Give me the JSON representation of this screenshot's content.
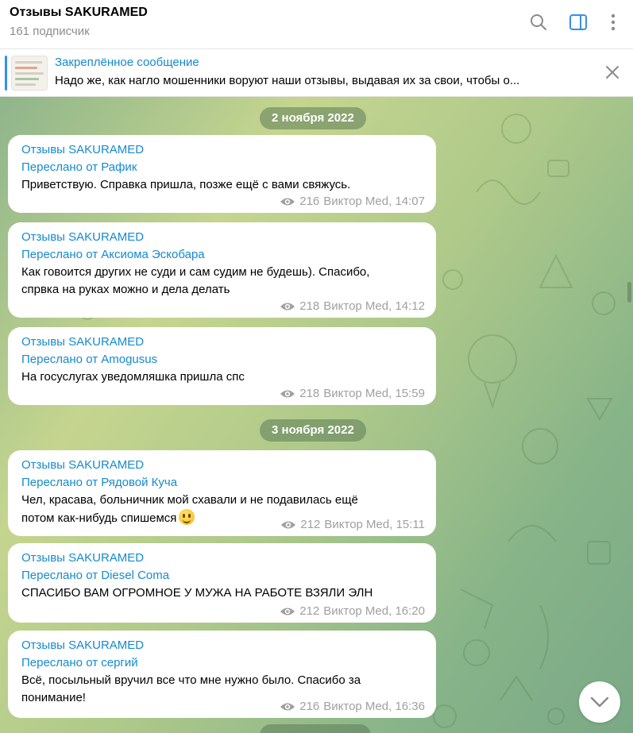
{
  "header": {
    "title": "Отзывы SAKURAMED",
    "subtitle": "161 подписчик",
    "icons": [
      "search-icon",
      "sidebar-toggle-icon",
      "more-vertical-icon"
    ]
  },
  "pinned": {
    "title": "Закреплённое сообщение",
    "text": "Надо же, как нагло мошенники воруют наши отзывы, выдавая их за свои, чтобы о..."
  },
  "dates": [
    "2 ноября 2022",
    "3 ноября 2022"
  ],
  "messages": [
    {
      "channel": "Отзывы SAKURAMED",
      "forwarded": "Переслано от Рафик",
      "lines": [
        "Приветствую. Справка пришла, позже ещё с вами свяжусь."
      ],
      "views": "216",
      "author_time": "Виктор Med, 14:07"
    },
    {
      "channel": "Отзывы SAKURAMED",
      "forwarded": "Переслано от Аксиома Эскобара",
      "lines": [
        "Как говоится других не суди и сам судим не будешь). Спасибо,",
        "спрвка на руках можно и дела делать"
      ],
      "views": "218",
      "author_time": "Виктор Med, 14:12"
    },
    {
      "channel": "Отзывы SAKURAMED",
      "forwarded": "Переслано от Amogusus",
      "lines": [
        "На госуслугах уведомляшка пришла спс"
      ],
      "views": "218",
      "author_time": "Виктор Med, 15:59"
    },
    {
      "channel": "Отзывы SAKURAMED",
      "forwarded": "Переслано от Рядовой Куча",
      "lines": [
        "Чел, красава, больничник мой схавали и не подавилась ещё",
        "потом как-нибудь спишемся"
      ],
      "views": "212",
      "author_time": "Виктор Med, 15:11"
    },
    {
      "channel": "Отзывы SAKURAMED",
      "forwarded": "Переслано от Diesel Coma",
      "lines": [
        "СПАСИБО ВАМ ОГРОМНОЕ У МУЖА НА РАБОТЕ ВЗЯЛИ ЭЛН"
      ],
      "views": "212",
      "author_time": "Виктор Med, 16:20"
    },
    {
      "channel": "Отзывы SAKURAMED",
      "forwarded": "Переслано от сергий",
      "lines": [
        "Всё, посыльный вручил все что мне нужно было. Спасибо за",
        "понимание!"
      ],
      "views": "216",
      "author_time": "Виктор Med, 16:36"
    }
  ],
  "colors": {
    "accent": "#168acd",
    "date_pill": "#5c7c58",
    "bubble": "#ffffff",
    "meta": "#a0a0a0"
  }
}
